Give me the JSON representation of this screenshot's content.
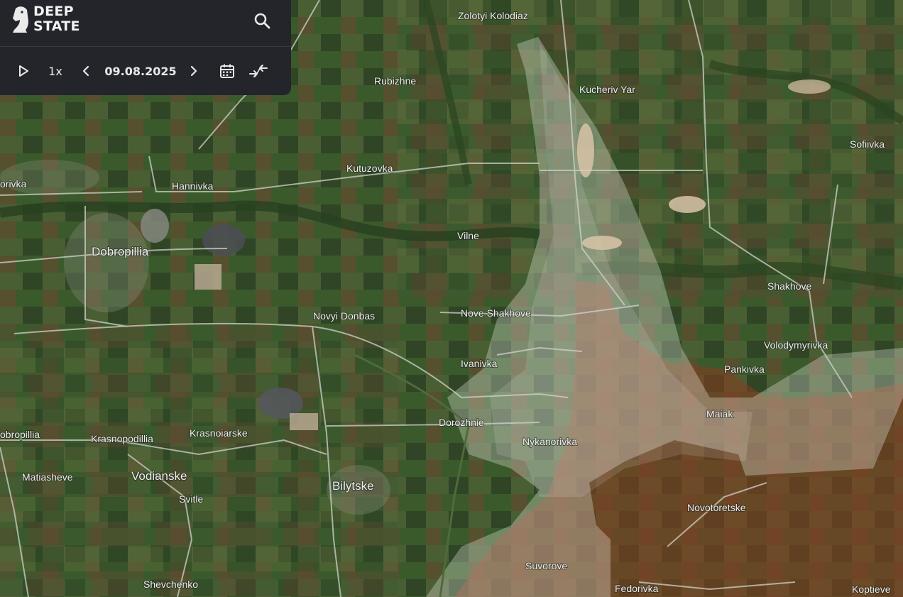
{
  "brand": {
    "line1": "DEEP",
    "line2": "STATE"
  },
  "toolbar": {
    "speed": "1x",
    "date": "09.08.2025"
  },
  "icons": [
    "logo-knight-icon",
    "search-icon",
    "play-icon",
    "chevron-left-icon",
    "chevron-right-icon",
    "calendar-icon",
    "collapse-arrows-icon"
  ],
  "colors": {
    "panel": "#24252b",
    "occupied": "#8a3a1f",
    "contested": "#e8ece4"
  },
  "labels": {
    "zolotyi_kolodiaz": "Zolotyi Kolodiaz",
    "rubizhne": "Rubizhne",
    "kucheriv_yar": "Kucheriv Yar",
    "sofiivka": "Sofiivka",
    "kutuzovka": "Kutuzovka",
    "orivka": "orivka",
    "hannivka": "Hannivka",
    "vilne": "Vilne",
    "dobropillia": "Dobropillia",
    "shakhove": "Shakhove",
    "nove_shakhove": "Nove Shakhove",
    "novyi_donbas": "Novyi Donbas",
    "volodymyrivka": "Volodymyrivka",
    "ivanivka": "Ivanivka",
    "pankivka": "Pankivka",
    "maiak": "Maiak",
    "dorozhnie": "Dorozhnie",
    "obropillia": "obropillia",
    "krasnopodillia": "Krasnopodillia",
    "krasnoiarske": "Krasnoiarske",
    "nykanorivka": "Nykanorivka",
    "matiasheve": "Matiasheve",
    "vodianske": "Vodianske",
    "bilytske": "Bilytske",
    "svitle": "Svitle",
    "novotoretske": "Novotoretske",
    "suvorove": "Suvorove",
    "shevchenko": "Shevchenko",
    "fedorivka": "Fedorivka",
    "koptieve": "Koptieve"
  }
}
